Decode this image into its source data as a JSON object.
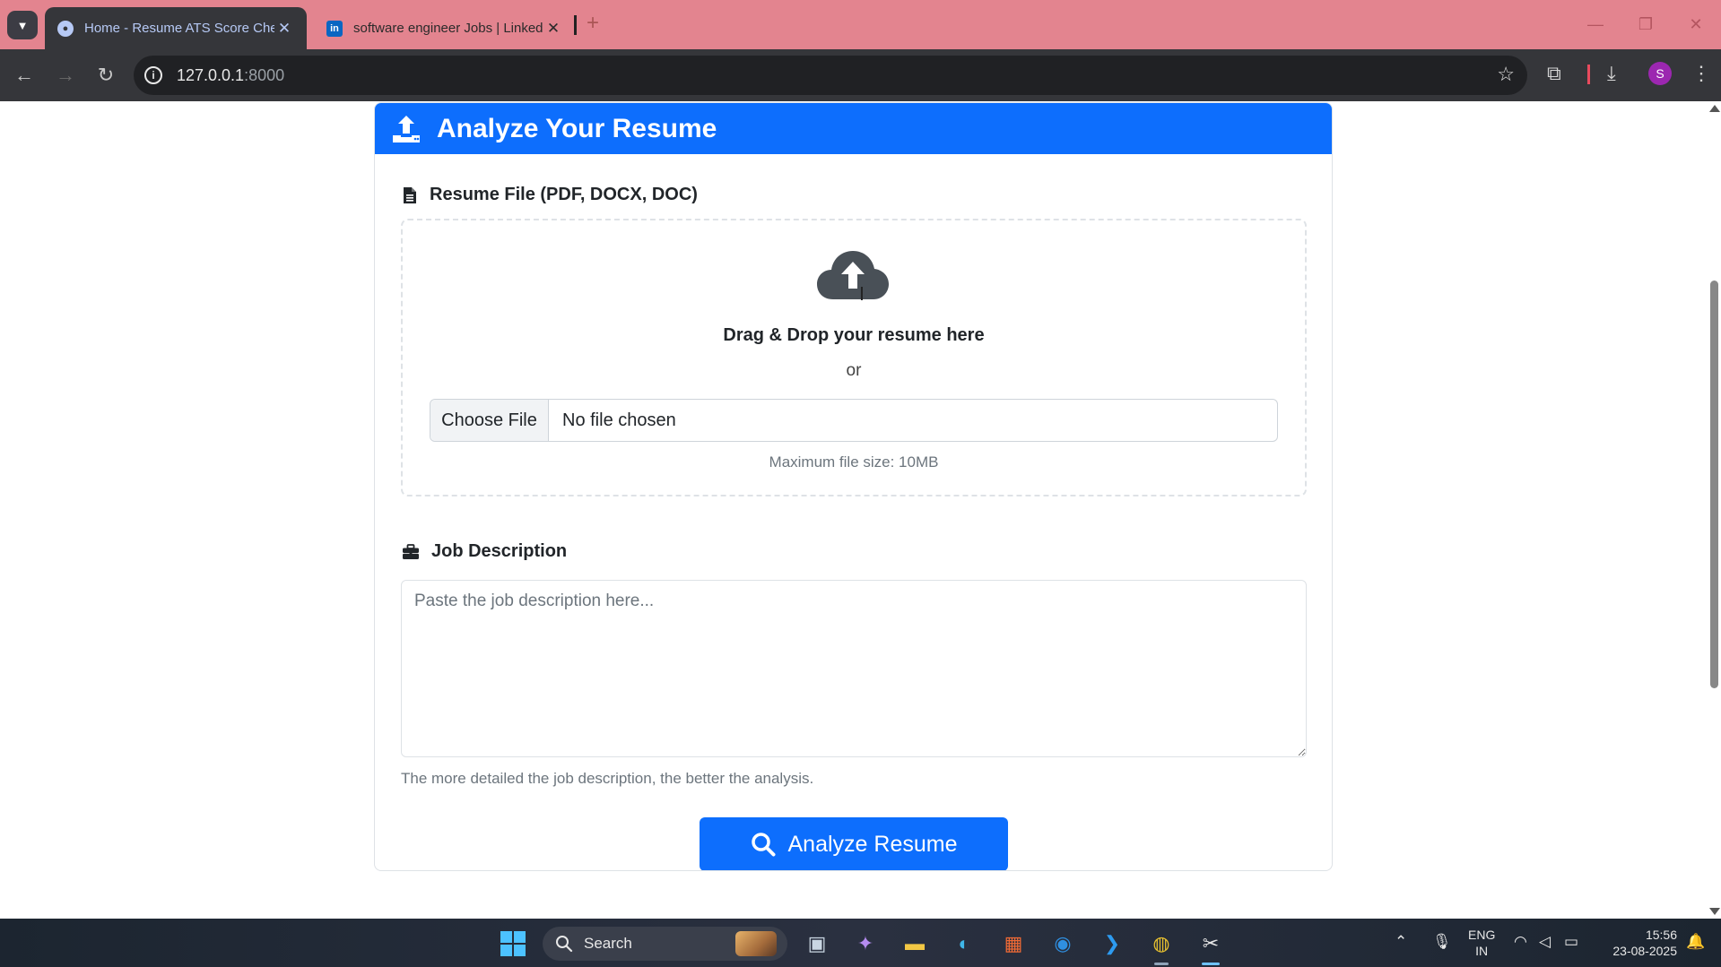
{
  "browser": {
    "tabs": [
      {
        "title": "Home - Resume ATS Score Che",
        "active": true
      },
      {
        "title": "software engineer Jobs | Linked",
        "active": false
      }
    ],
    "close_glyph": "✕",
    "new_tab_glyph": "+",
    "url_host": "127.0.0.1",
    "url_port": ":8000",
    "profile_initial": "S"
  },
  "page": {
    "header_title": "Analyze Your Resume",
    "resume_label": "Resume File (PDF, DOCX, DOC)",
    "dropzone_title": "Drag & Drop your resume here",
    "dropzone_or": "or",
    "file_button": "Choose File",
    "file_status": "No file chosen",
    "max_size_note": "Maximum file size: 10MB",
    "job_label": "Job Description",
    "job_placeholder": "Paste the job description here...",
    "job_help": "The more detailed the job description, the better the analysis.",
    "analyze_button": "Analyze Resume"
  },
  "taskbar": {
    "search_label": "Search",
    "lang_top": "ENG",
    "lang_bottom": "IN",
    "time": "15:56",
    "date": "23-08-2025"
  },
  "colors": {
    "primary": "#0d6efd",
    "tab_strip": "#e3848f",
    "chrome_dark": "#35363a"
  }
}
